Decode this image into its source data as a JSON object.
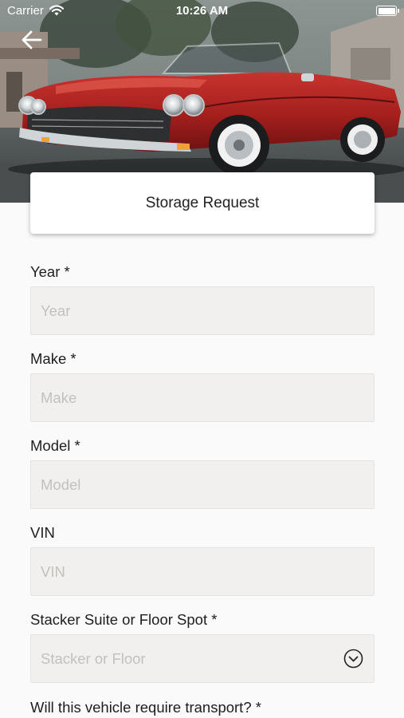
{
  "status_bar": {
    "carrier": "Carrier",
    "time": "10:26 AM"
  },
  "header": {
    "title": "Storage Request"
  },
  "form": {
    "year": {
      "label": "Year *",
      "placeholder": "Year"
    },
    "make": {
      "label": "Make *",
      "placeholder": "Make"
    },
    "model": {
      "label": "Model *",
      "placeholder": "Model"
    },
    "vin": {
      "label": "VIN",
      "placeholder": "VIN"
    },
    "spot": {
      "label": "Stacker Suite or Floor Spot *",
      "placeholder": "Stacker or Floor"
    },
    "transport": {
      "label": "Will this vehicle require transport? *"
    }
  },
  "icons": {
    "back": "arrow-left-icon",
    "wifi": "wifi-icon",
    "battery": "battery-icon",
    "dropdown": "chevron-down-circle-icon"
  }
}
